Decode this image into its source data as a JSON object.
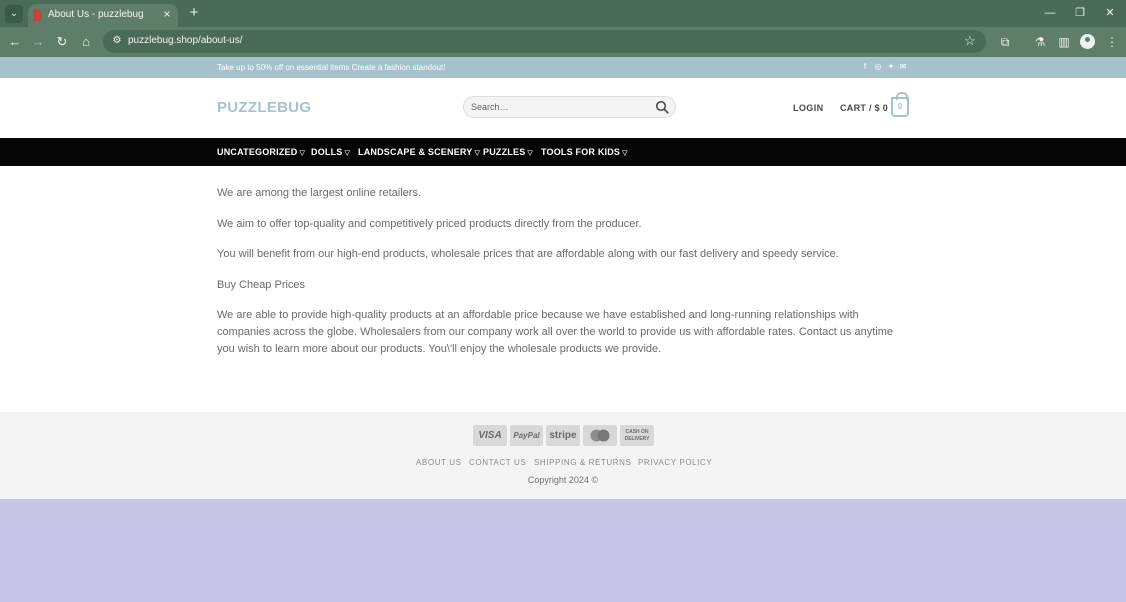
{
  "browser": {
    "tab_title": "About Us - puzzlebug",
    "url": "puzzlebug.shop/about-us/"
  },
  "topbar": {
    "promo": "Take up to 50% off on essential items Create a fashion standout!",
    "social_icons": [
      "facebook-icon",
      "instagram-icon",
      "twitter-icon",
      "email-icon"
    ]
  },
  "header": {
    "logo": "PUZZLEBUG",
    "search_placeholder": "Search…",
    "login": "LOGIN",
    "cart": "CART / $ 0",
    "cart_count": "0"
  },
  "nav": {
    "items": [
      {
        "label": "UNCATEGORIZED"
      },
      {
        "label": "DOLLS"
      },
      {
        "label": "LANDSCAPE & SCENERY"
      },
      {
        "label": "PUZZLES"
      },
      {
        "label": "TOOLS FOR KIDS"
      }
    ]
  },
  "content": {
    "paragraphs": [
      "We are among the largest online retailers.",
      "We aim to offer top-quality and competitively priced products directly from the producer.",
      "You will benefit from our high-end products, wholesale prices that are affordable along with our fast delivery and speedy service.",
      "Buy Cheap Prices",
      "We are able to provide high-quality products at an affordable price because we have established and long-running relationships with companies across the globe. Wholesalers from our company work all over the world to provide us with affordable rates. Contact us anytime you wish to learn more about our products. You\\'ll enjoy the wholesale products we provide."
    ]
  },
  "footer": {
    "payments": {
      "visa": "VISA",
      "paypal": "PayPal",
      "stripe": "stripe",
      "mastercard": "MasterCard",
      "cod": "CASH ON DELIVERY"
    },
    "links": [
      {
        "label": "ABOUT US"
      },
      {
        "label": "CONTACT US"
      },
      {
        "label": "SHIPPING & RETURNS"
      },
      {
        "label": "PRIVACY POLICY"
      }
    ],
    "copyright": "Copyright 2024 ©"
  },
  "colors": {
    "accent": "#a6c2cb",
    "nav_bg": "#050505",
    "chrome": "#5e7e6a",
    "page_bg": "#c9c5e6"
  }
}
